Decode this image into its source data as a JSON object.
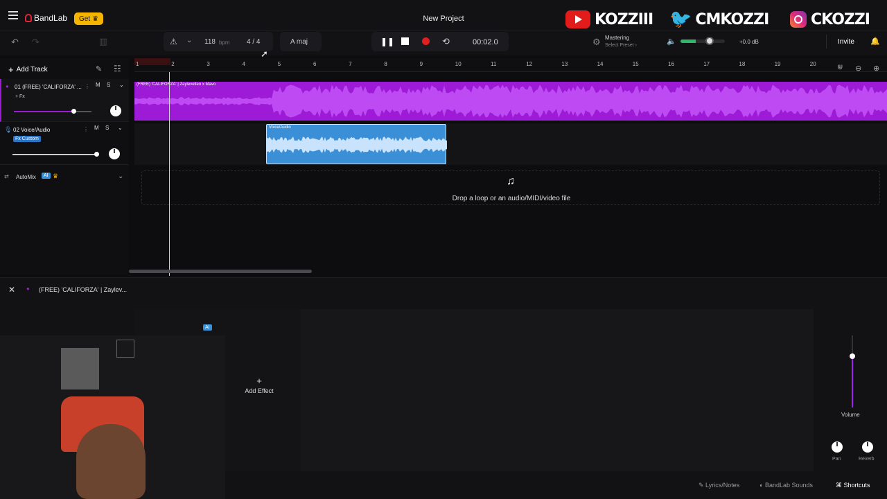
{
  "header": {
    "app_name": "BandLab",
    "get_label": "Get",
    "project_title": "New Project",
    "invite_label": "Invite"
  },
  "overlay": {
    "youtube": "KOZZIII",
    "twitter": "CMKOZZI",
    "instagram": "CKOZZI"
  },
  "transport": {
    "bpm_value": "118",
    "bpm_unit": "bpm",
    "time_sig": "4 / 4",
    "key": "A maj",
    "time": "00:02.0",
    "mastering_label": "Mastering",
    "mastering_preset": "Select Preset",
    "db_value": "+0.0 dB"
  },
  "sidebar": {
    "add_track_label": "Add Track",
    "tracks": [
      {
        "name": "01  (FREE) 'CALIFORZA' ...",
        "sub": "+ Fx",
        "mute": "M",
        "solo": "S",
        "volume_level": 0.83
      },
      {
        "name": "02  Voice/Audio",
        "sub": "Fx Custom",
        "mute": "M",
        "solo": "S",
        "volume_level": 0.98
      }
    ],
    "automix_label": "AutoMix",
    "automix_badge": "AI"
  },
  "timeline": {
    "bars": [
      "1",
      "2",
      "3",
      "4",
      "5",
      "6",
      "7",
      "8",
      "9",
      "10",
      "11",
      "12",
      "13",
      "14",
      "15",
      "16",
      "17",
      "18",
      "19",
      "20"
    ],
    "clip1_label": "(FREE) 'CALIFORZA'  |  Zaylevelten x Mavo",
    "clip2_label": "Voice/Audio",
    "drop_text": "Drop a loop or an audio/MIDI/video file"
  },
  "bottom": {
    "track_title": "(FREE) 'CALIFORZA'  |  Zaylev...",
    "ai_badge": "AI",
    "add_effect_label": "Add Effect",
    "volume_label": "Volume",
    "pan_label": "Pan",
    "reverb_label": "Reverb",
    "lyrics_label": "Lyrics/Notes",
    "sounds_label": "BandLab Sounds",
    "shortcuts_label": "Shortcuts"
  },
  "colors": {
    "track1": "#9d1ad6",
    "track2": "#3b8fd6",
    "record": "#e02020",
    "accent": "#f4b400"
  }
}
